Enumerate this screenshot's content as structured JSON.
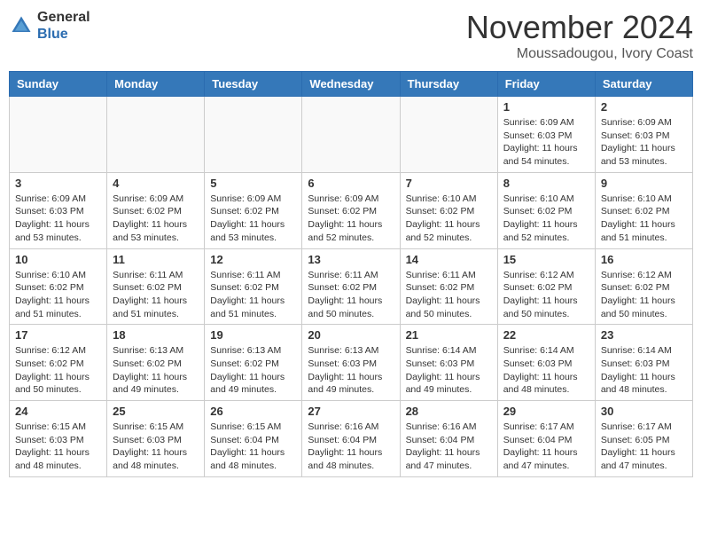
{
  "header": {
    "logo_general": "General",
    "logo_blue": "Blue",
    "month_title": "November 2024",
    "location": "Moussadougou, Ivory Coast"
  },
  "days_of_week": [
    "Sunday",
    "Monday",
    "Tuesday",
    "Wednesday",
    "Thursday",
    "Friday",
    "Saturday"
  ],
  "weeks": [
    [
      {
        "day": "",
        "info": ""
      },
      {
        "day": "",
        "info": ""
      },
      {
        "day": "",
        "info": ""
      },
      {
        "day": "",
        "info": ""
      },
      {
        "day": "",
        "info": ""
      },
      {
        "day": "1",
        "info": "Sunrise: 6:09 AM\nSunset: 6:03 PM\nDaylight: 11 hours\nand 54 minutes."
      },
      {
        "day": "2",
        "info": "Sunrise: 6:09 AM\nSunset: 6:03 PM\nDaylight: 11 hours\nand 53 minutes."
      }
    ],
    [
      {
        "day": "3",
        "info": "Sunrise: 6:09 AM\nSunset: 6:03 PM\nDaylight: 11 hours\nand 53 minutes."
      },
      {
        "day": "4",
        "info": "Sunrise: 6:09 AM\nSunset: 6:02 PM\nDaylight: 11 hours\nand 53 minutes."
      },
      {
        "day": "5",
        "info": "Sunrise: 6:09 AM\nSunset: 6:02 PM\nDaylight: 11 hours\nand 53 minutes."
      },
      {
        "day": "6",
        "info": "Sunrise: 6:09 AM\nSunset: 6:02 PM\nDaylight: 11 hours\nand 52 minutes."
      },
      {
        "day": "7",
        "info": "Sunrise: 6:10 AM\nSunset: 6:02 PM\nDaylight: 11 hours\nand 52 minutes."
      },
      {
        "day": "8",
        "info": "Sunrise: 6:10 AM\nSunset: 6:02 PM\nDaylight: 11 hours\nand 52 minutes."
      },
      {
        "day": "9",
        "info": "Sunrise: 6:10 AM\nSunset: 6:02 PM\nDaylight: 11 hours\nand 51 minutes."
      }
    ],
    [
      {
        "day": "10",
        "info": "Sunrise: 6:10 AM\nSunset: 6:02 PM\nDaylight: 11 hours\nand 51 minutes."
      },
      {
        "day": "11",
        "info": "Sunrise: 6:11 AM\nSunset: 6:02 PM\nDaylight: 11 hours\nand 51 minutes."
      },
      {
        "day": "12",
        "info": "Sunrise: 6:11 AM\nSunset: 6:02 PM\nDaylight: 11 hours\nand 51 minutes."
      },
      {
        "day": "13",
        "info": "Sunrise: 6:11 AM\nSunset: 6:02 PM\nDaylight: 11 hours\nand 50 minutes."
      },
      {
        "day": "14",
        "info": "Sunrise: 6:11 AM\nSunset: 6:02 PM\nDaylight: 11 hours\nand 50 minutes."
      },
      {
        "day": "15",
        "info": "Sunrise: 6:12 AM\nSunset: 6:02 PM\nDaylight: 11 hours\nand 50 minutes."
      },
      {
        "day": "16",
        "info": "Sunrise: 6:12 AM\nSunset: 6:02 PM\nDaylight: 11 hours\nand 50 minutes."
      }
    ],
    [
      {
        "day": "17",
        "info": "Sunrise: 6:12 AM\nSunset: 6:02 PM\nDaylight: 11 hours\nand 50 minutes."
      },
      {
        "day": "18",
        "info": "Sunrise: 6:13 AM\nSunset: 6:02 PM\nDaylight: 11 hours\nand 49 minutes."
      },
      {
        "day": "19",
        "info": "Sunrise: 6:13 AM\nSunset: 6:02 PM\nDaylight: 11 hours\nand 49 minutes."
      },
      {
        "day": "20",
        "info": "Sunrise: 6:13 AM\nSunset: 6:03 PM\nDaylight: 11 hours\nand 49 minutes."
      },
      {
        "day": "21",
        "info": "Sunrise: 6:14 AM\nSunset: 6:03 PM\nDaylight: 11 hours\nand 49 minutes."
      },
      {
        "day": "22",
        "info": "Sunrise: 6:14 AM\nSunset: 6:03 PM\nDaylight: 11 hours\nand 48 minutes."
      },
      {
        "day": "23",
        "info": "Sunrise: 6:14 AM\nSunset: 6:03 PM\nDaylight: 11 hours\nand 48 minutes."
      }
    ],
    [
      {
        "day": "24",
        "info": "Sunrise: 6:15 AM\nSunset: 6:03 PM\nDaylight: 11 hours\nand 48 minutes."
      },
      {
        "day": "25",
        "info": "Sunrise: 6:15 AM\nSunset: 6:03 PM\nDaylight: 11 hours\nand 48 minutes."
      },
      {
        "day": "26",
        "info": "Sunrise: 6:15 AM\nSunset: 6:04 PM\nDaylight: 11 hours\nand 48 minutes."
      },
      {
        "day": "27",
        "info": "Sunrise: 6:16 AM\nSunset: 6:04 PM\nDaylight: 11 hours\nand 48 minutes."
      },
      {
        "day": "28",
        "info": "Sunrise: 6:16 AM\nSunset: 6:04 PM\nDaylight: 11 hours\nand 47 minutes."
      },
      {
        "day": "29",
        "info": "Sunrise: 6:17 AM\nSunset: 6:04 PM\nDaylight: 11 hours\nand 47 minutes."
      },
      {
        "day": "30",
        "info": "Sunrise: 6:17 AM\nSunset: 6:05 PM\nDaylight: 11 hours\nand 47 minutes."
      }
    ]
  ]
}
